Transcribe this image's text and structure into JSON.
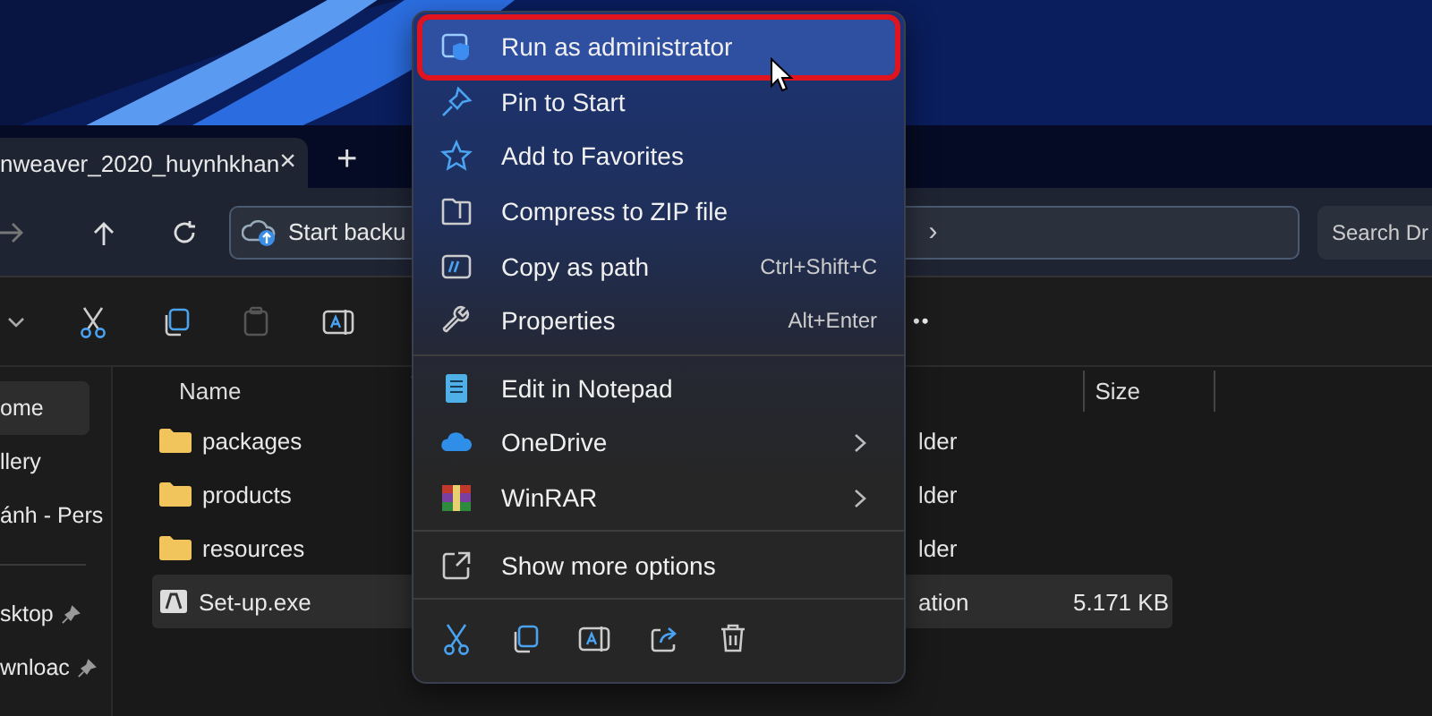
{
  "tab": {
    "title": "nweaver_2020_huynhkhan",
    "close": "×",
    "new_tab": "+"
  },
  "address_bar": {
    "segment": "Start backu",
    "separator": "›"
  },
  "search": {
    "placeholder": "Search Dr"
  },
  "command_bar": {
    "more": "••"
  },
  "sidebar": {
    "groups": [
      [
        {
          "label": "ome",
          "selected": true,
          "pinned": false
        },
        {
          "label": "llery",
          "selected": false,
          "pinned": false
        },
        {
          "label": "ánh - Pers",
          "selected": false,
          "pinned": false
        }
      ],
      [
        {
          "label": "sktop",
          "selected": false,
          "pinned": true
        },
        {
          "label": "wnloac",
          "selected": false,
          "pinned": true
        }
      ]
    ]
  },
  "file_list": {
    "columns": [
      "Name",
      "Size"
    ],
    "rows": [
      {
        "kind": "folder",
        "name": "packages",
        "type": "lder",
        "selected": false
      },
      {
        "kind": "folder",
        "name": "products",
        "type": "lder",
        "selected": false
      },
      {
        "kind": "folder",
        "name": "resources",
        "type": "lder",
        "selected": false
      },
      {
        "kind": "file",
        "name": "Set-up.exe",
        "type": "ation",
        "size": "5.171 KB",
        "selected": true
      }
    ]
  },
  "context_menu": {
    "groups": [
      [
        {
          "label": "Run as administrator",
          "submenu": false,
          "highlighted": true
        },
        {
          "label": "Pin to Start",
          "submenu": false,
          "highlighted": false
        },
        {
          "label": "Add to Favorites",
          "submenu": false,
          "highlighted": false
        },
        {
          "label": "Compress to ZIP file",
          "submenu": false,
          "highlighted": false
        },
        {
          "label": "Copy as path",
          "shortcut": "Ctrl+Shift+C",
          "submenu": false,
          "highlighted": false
        },
        {
          "label": "Properties",
          "shortcut": "Alt+Enter",
          "submenu": false,
          "highlighted": false
        }
      ],
      [
        {
          "label": "Edit in Notepad",
          "submenu": false,
          "highlighted": false
        },
        {
          "label": "OneDrive",
          "submenu": true,
          "highlighted": false
        },
        {
          "label": "WinRAR",
          "submenu": true,
          "highlighted": false
        }
      ],
      [
        {
          "label": "Show more options",
          "submenu": false,
          "highlighted": false
        }
      ]
    ]
  }
}
